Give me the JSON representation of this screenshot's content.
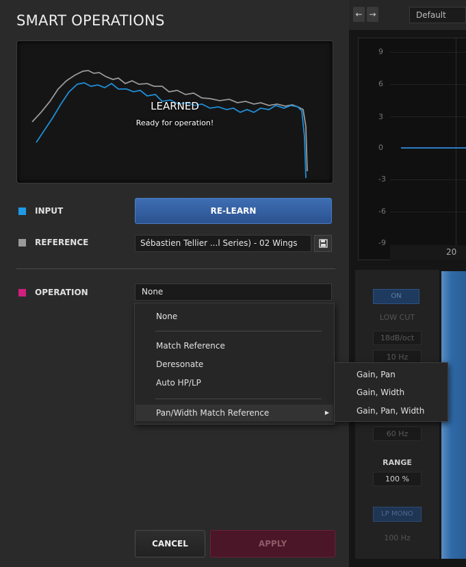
{
  "panel": {
    "title": "SMART OPERATIONS",
    "status_title": "LEARNED",
    "status_subtitle": "Ready for operation!"
  },
  "input": {
    "label": "INPUT",
    "color": "#1e9be8",
    "button_label": "RE-LEARN"
  },
  "reference": {
    "label": "REFERENCE",
    "color": "#9a9a9a",
    "value": "Sébastien Tellier ...l Series) - 02 Wings",
    "save_icon": "save-icon"
  },
  "operation": {
    "label": "OPERATION",
    "color": "#d01f7e",
    "selected": "None",
    "menu": {
      "items": [
        "None",
        "Match Reference",
        "Deresonate",
        "Auto HP/LP",
        "Pan/Width Match Reference"
      ],
      "submenu": [
        "Gain, Pan",
        "Gain, Width",
        "Gain, Pan, Width"
      ]
    }
  },
  "footer": {
    "cancel_label": "CANCEL",
    "apply_label": "APPLY"
  },
  "background_plugin": {
    "preset": "Default",
    "nav_back_icon": "arrow-left-icon",
    "nav_forward_icon": "arrow-right-icon",
    "y_ticks": [
      "9",
      "6",
      "3",
      "0",
      "-3",
      "-6",
      "-9"
    ],
    "x_label": "20",
    "band": {
      "on_label": "ON",
      "type": "LOW CUT",
      "slope": "18dB/oct",
      "freq": "10 Hz",
      "freq2": "60 Hz",
      "range_label": "RANGE",
      "range_value": "100 %",
      "lpmono_label": "LP MONO",
      "lpmono_freq": "100 Hz"
    }
  }
}
